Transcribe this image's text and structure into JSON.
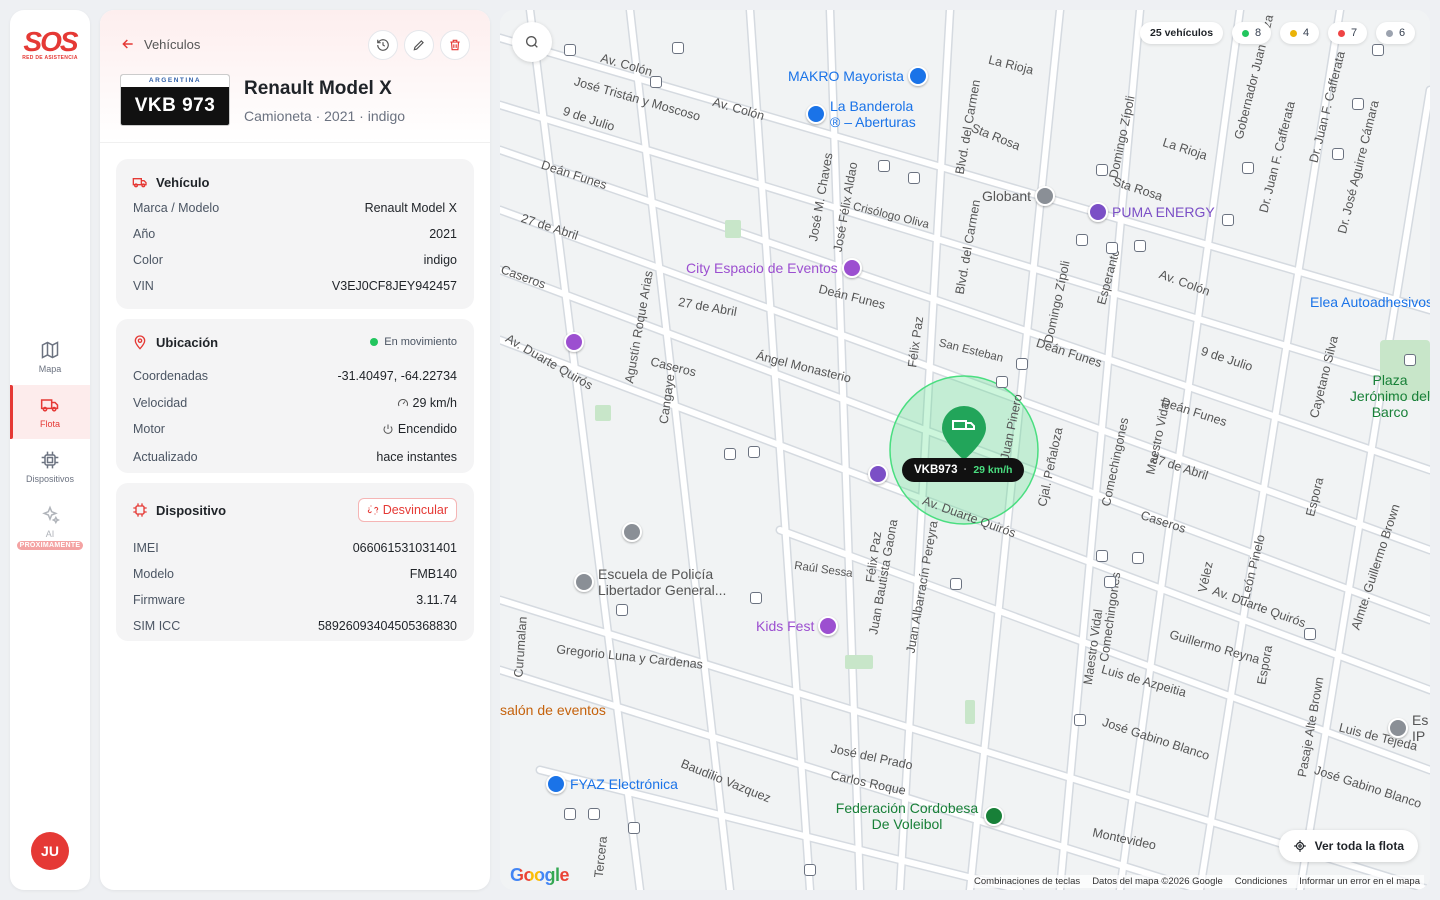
{
  "brand": {
    "logo": "SOS",
    "tagline": "RED DE ASISTENCIA"
  },
  "nav": [
    {
      "label": "Mapa",
      "icon": "map-icon"
    },
    {
      "label": "Flota",
      "icon": "truck-icon",
      "active": true
    },
    {
      "label": "Dispositivos",
      "icon": "chip-icon"
    },
    {
      "label": "AI",
      "icon": "sparkles-icon",
      "badge": "PRÓXIMAMENTE"
    }
  ],
  "user": {
    "initials": "JU"
  },
  "header": {
    "back_label": "Vehículos",
    "plate_country": "ARGENTINA",
    "plate": "VKB 973",
    "title": "Renault Model X",
    "subtitle": "Camioneta · 2021 · indigo"
  },
  "vehicle": {
    "title": "Vehículo",
    "rows": [
      {
        "k": "Marca / Modelo",
        "v": "Renault Model X"
      },
      {
        "k": "Año",
        "v": "2021"
      },
      {
        "k": "Color",
        "v": "indigo"
      },
      {
        "k": "VIN",
        "v": "V3EJ0CF8JEY942457"
      }
    ]
  },
  "location": {
    "title": "Ubicación",
    "status": "En movimiento",
    "rows": [
      {
        "k": "Coordenadas",
        "v": "-31.40497, -64.22734"
      },
      {
        "k": "Velocidad",
        "v": "29 km/h"
      },
      {
        "k": "Motor",
        "v": "Encendido"
      },
      {
        "k": "Actualizado",
        "v": "hace instantes"
      }
    ]
  },
  "device": {
    "title": "Dispositivo",
    "unlink_label": "Desvincular",
    "rows": [
      {
        "k": "IMEI",
        "v": "066061531031401"
      },
      {
        "k": "Modelo",
        "v": "FMB140"
      },
      {
        "k": "Firmware",
        "v": "3.11.74"
      },
      {
        "k": "SIM ICC",
        "v": "58926093404505368830"
      }
    ]
  },
  "map": {
    "fleet_count": "25 vehículos",
    "counts": [
      {
        "n": "8",
        "color": "#22c55e"
      },
      {
        "n": "4",
        "color": "#eab308"
      },
      {
        "n": "7",
        "color": "#ef4444"
      },
      {
        "n": "6",
        "color": "#9ca3af"
      }
    ],
    "vehicle_label": "VKB973",
    "vehicle_speed": "29 km/h",
    "fleet_button": "Ver toda la flota",
    "footer": [
      "Combinaciones de teclas",
      "Datos del mapa ©2026 Google",
      "Condiciones",
      "Informar un error en el mapa"
    ],
    "google": "Google",
    "streets": [
      "Av. Colón",
      "José Tristán y Moscoso",
      "9 de Julio",
      "Deán Funes",
      "27 de Abril",
      "Caseros",
      "Av. Duarte Quirós",
      "Agustín Roque Arias",
      "Cangaye",
      "Ángel Monasterio",
      "San Esteban",
      "Crisólogo Oliva",
      "José M. Chaves",
      "José Félix Aldao",
      "Blvd. del Carmen",
      "Sta Rosa",
      "La Rioja",
      "Domingo Zípoli",
      "Esperanto",
      "Félix Paz",
      "Juan Pinero",
      "Cjal. Peñaloza",
      "Comechingones",
      "Maestro Vidal",
      "Juan Bautista Gaona",
      "Juan Albarracín Pereyra",
      "Raúl Sessa",
      "Gregorio Luna y Cardenas",
      "José del Prado",
      "Carlos Roque",
      "Baudilio Vazquez",
      "Guillermo Reyna",
      "Luis de Azpeitia",
      "José Gabino Blanco",
      "Montevideo",
      "Dr. Juan F. Cafferata",
      "Gobernador Juan Loza",
      "Cayetano Silva",
      "Vélez",
      "León Pinelo",
      "Espora",
      "Almte. Guillermo Brown",
      "Pasaje Alte Brown",
      "Dr. José Aguirre Cámara",
      "Luis de Tejeda",
      "Curumalan",
      "Tercera"
    ],
    "pois": [
      {
        "name": "MAKRO Mayorista",
        "color": "#1a73e8"
      },
      {
        "name": "La Banderola ® – Aberturas",
        "color": "#1a73e8"
      },
      {
        "name": "Globant",
        "color": "#6b7280"
      },
      {
        "name": "PUMA ENERGY",
        "color": "#7b4fc6"
      },
      {
        "name": "City Espacio de Eventos",
        "color": "#9c4fd0"
      },
      {
        "name": "Elea Autoadhesivos",
        "color": "#1a73e8"
      },
      {
        "name": "Plaza Jerónimo del Barco",
        "color": "#188038"
      },
      {
        "name": "Escuela de Policía Libertador General...",
        "color": "#6b7280"
      },
      {
        "name": "Kids Fest",
        "color": "#9c4fd0"
      },
      {
        "name": "salón de eventos",
        "color": "#c5620c"
      },
      {
        "name": "FYAZ Electrónica",
        "color": "#1a73e8"
      },
      {
        "name": "Federación Cordobesa De Voleibol",
        "color": "#188038"
      },
      {
        "name": "Es IP",
        "color": "#6b7280"
      }
    ]
  }
}
